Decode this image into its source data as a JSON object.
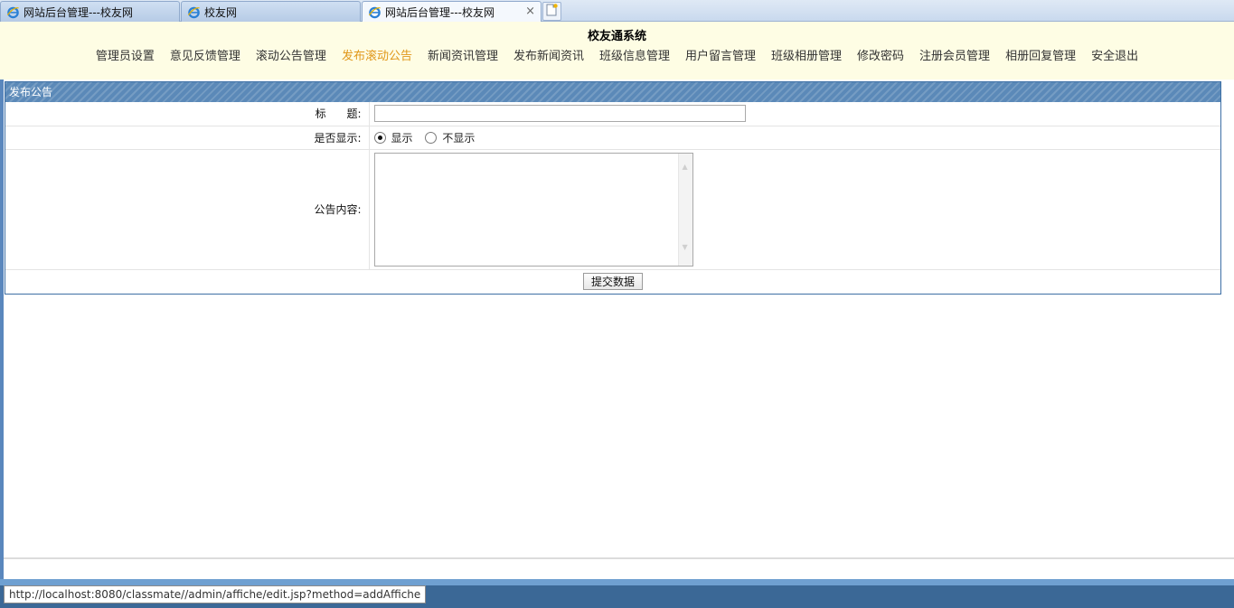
{
  "browser": {
    "tabs": [
      {
        "label": "网站后台管理---校友网",
        "active": false
      },
      {
        "label": "校友网",
        "active": false
      },
      {
        "label": "网站后台管理---校友网",
        "active": true
      }
    ],
    "close_glyph": "×",
    "tab_icon": "ie-logo-icon",
    "new_tab_icon": "new-tab-icon",
    "status_url": "http://localhost:8080/classmate//admin/affiche/edit.jsp?method=addAffiche"
  },
  "header": {
    "title": "校友通系统",
    "nav": [
      {
        "label": "管理员设置",
        "current": false
      },
      {
        "label": "意见反馈管理",
        "current": false
      },
      {
        "label": "滚动公告管理",
        "current": false
      },
      {
        "label": "发布滚动公告",
        "current": true
      },
      {
        "label": "新闻资讯管理",
        "current": false
      },
      {
        "label": "发布新闻资讯",
        "current": false
      },
      {
        "label": "班级信息管理",
        "current": false
      },
      {
        "label": "用户留言管理",
        "current": false
      },
      {
        "label": "班级相册管理",
        "current": false
      },
      {
        "label": "修改密码",
        "current": false
      },
      {
        "label": "注册会员管理",
        "current": false
      },
      {
        "label": "相册回复管理",
        "current": false
      },
      {
        "label": "安全退出",
        "current": false
      }
    ]
  },
  "form": {
    "heading": "发布公告",
    "title_label": "标      题:",
    "title_value": "",
    "display_label": "是否显示:",
    "display_options": [
      "显示",
      "不显示"
    ],
    "display_selected": "显示",
    "content_label": "公告内容:",
    "content_value": "",
    "submit_label": "提交数据"
  },
  "colors": {
    "header_bg": "#fefde4",
    "nav_current": "#e0971a",
    "panel_border": "#3d6fa5",
    "panel_head": "#5b89b8",
    "statusbar": "#3b6896"
  }
}
